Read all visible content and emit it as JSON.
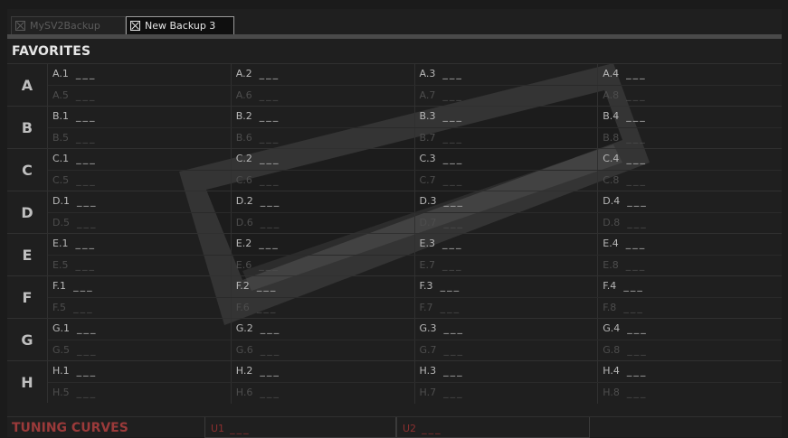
{
  "tabs": [
    {
      "label": "MySV2Backup",
      "active": false
    },
    {
      "label": "New Backup 3",
      "active": true
    }
  ],
  "favorites": {
    "title": "FAVORITES",
    "empty_marker": "___",
    "groups": [
      {
        "letter": "A",
        "row1": [
          "A.1",
          "A.2",
          "A.3",
          "A.4"
        ],
        "row2": [
          "A.5",
          "A.6",
          "A.7",
          "A.8"
        ]
      },
      {
        "letter": "B",
        "row1": [
          "B.1",
          "B.2",
          "B.3",
          "B.4"
        ],
        "row2": [
          "B.5",
          "B.6",
          "B.7",
          "B.8"
        ]
      },
      {
        "letter": "C",
        "row1": [
          "C.1",
          "C.2",
          "C.3",
          "C.4"
        ],
        "row2": [
          "C.5",
          "C.6",
          "C.7",
          "C.8"
        ]
      },
      {
        "letter": "D",
        "row1": [
          "D.1",
          "D.2",
          "D.3",
          "D.4"
        ],
        "row2": [
          "D.5",
          "D.6",
          "D.7",
          "D.8"
        ]
      },
      {
        "letter": "E",
        "row1": [
          "E.1",
          "E.2",
          "E.3",
          "E.4"
        ],
        "row2": [
          "E.5",
          "E.6",
          "E.7",
          "E.8"
        ]
      },
      {
        "letter": "F",
        "row1": [
          "F.1",
          "F.2",
          "F.3",
          "F.4"
        ],
        "row2": [
          "F.5",
          "F.6",
          "F.7",
          "F.8"
        ]
      },
      {
        "letter": "G",
        "row1": [
          "G.1",
          "G.2",
          "G.3",
          "G.4"
        ],
        "row2": [
          "G.5",
          "G.6",
          "G.7",
          "G.8"
        ]
      },
      {
        "letter": "H",
        "row1": [
          "H.1",
          "H.2",
          "H.3",
          "H.4"
        ],
        "row2": [
          "H.5",
          "H.6",
          "H.7",
          "H.8"
        ]
      }
    ]
  },
  "tuning_curves": {
    "title": "TUNING CURVES",
    "slots": [
      {
        "label": "U1",
        "value": "___"
      },
      {
        "label": "U2",
        "value": "___"
      }
    ]
  },
  "colors": {
    "background": "#1f1f1f",
    "tuning_accent": "#9b3a3a"
  },
  "icons": {
    "tab_close": "close-box-icon"
  }
}
